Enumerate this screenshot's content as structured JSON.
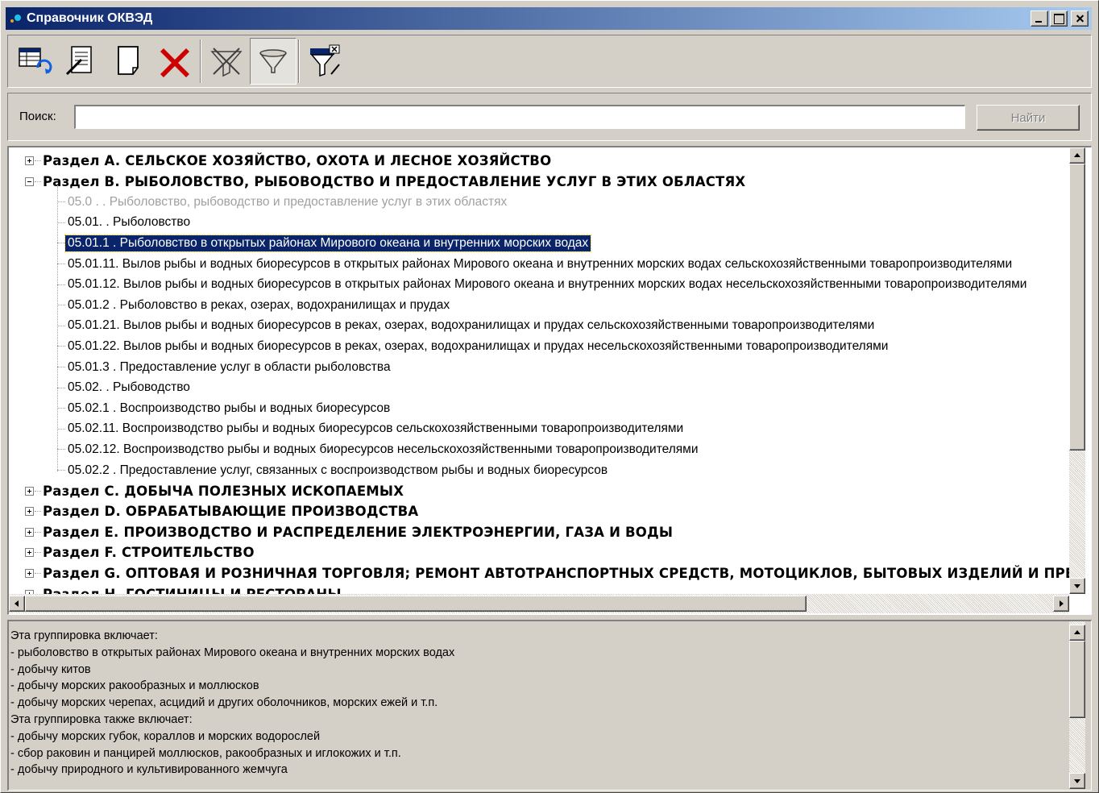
{
  "window": {
    "title": "Справочник ОКВЭД"
  },
  "toolbar": {
    "tools": [
      {
        "name": "refresh-table",
        "icon": "table-refresh-icon"
      },
      {
        "name": "edit-document",
        "icon": "document-edit-icon"
      },
      {
        "name": "new-document",
        "icon": "blank-page-icon"
      },
      {
        "name": "delete",
        "icon": "red-x-icon"
      },
      {
        "name": "clear-filter",
        "icon": "filter-clear-icon"
      },
      {
        "name": "filter",
        "icon": "funnel-icon",
        "pressed": true
      },
      {
        "name": "filter-settings",
        "icon": "filter-settings-icon"
      }
    ]
  },
  "search": {
    "label": "Поиск:",
    "value": "",
    "button_label": "Найти"
  },
  "tree": {
    "rows": [
      {
        "type": "section",
        "expanded": false,
        "text": "Раздел A. СЕЛЬСКОЕ ХОЗЯЙСТВО, ОХОТА И ЛЕСНОЕ ХОЗЯЙСТВО"
      },
      {
        "type": "section",
        "expanded": true,
        "text": "Раздел B. РЫБОЛОВСТВО, РЫБОВОДСТВО И ПРЕДОСТАВЛЕНИЕ УСЛУГ В ЭТИХ ОБЛАСТЯХ"
      },
      {
        "type": "leaf",
        "grey": true,
        "text": "05.0 . . Рыболовство, рыбоводство и предоставление услуг  в  этих областях"
      },
      {
        "type": "leaf",
        "text": "05.01.  . Рыболовство"
      },
      {
        "type": "leaf",
        "selected": true,
        "text": "05.01.1 . Рыболовство в открытых районах Мирового океана и внутренних морских водах"
      },
      {
        "type": "leaf",
        "text": "05.01.11. Вылов рыбы  и  водных  биоресурсов  в  открытых  районах Мирового   океана    и    внутренних    морских    водах сельскохозяйственными товаропроизводителями"
      },
      {
        "type": "leaf",
        "text": "05.01.12. Вылов рыбы  и  водных  биоресурсов  в  открытых  районах Мирового    океана    и    внутренних    морских   водах несельскохозяйственными товаропроизводителями"
      },
      {
        "type": "leaf",
        "text": "05.01.2 . Рыболовство в реках, озерах, водохранилищах и прудах"
      },
      {
        "type": "leaf",
        "text": "05.01.21. Вылов рыбы  и  водных  биоресурсов  в   реках,   озерах, водохранилищах    и    прудах   сельскохозяйственными товаропроизводителями"
      },
      {
        "type": "leaf",
        "text": "05.01.22. Вылов рыбы   и   водных  биоресурсов  в  реках,  озерах, водохранилищах    и    прудах    несельскохозяйственными товаропроизводителями"
      },
      {
        "type": "leaf",
        "text": "05.01.3 . Предоставление услуг в области рыболовства"
      },
      {
        "type": "leaf",
        "text": "05.02.  . Рыбоводство"
      },
      {
        "type": "leaf",
        "text": "05.02.1 . Воспроизводство рыбы и водных биоресурсов"
      },
      {
        "type": "leaf",
        "text": "05.02.11. Воспроизводство рыбы      и      водных      биоресурсов сельскохозяйственными товаропроизводителями"
      },
      {
        "type": "leaf",
        "text": "05.02.12. Воспроизводство рыбы      и      водных      биоресурсов несельскохозяйственными товаропроизводителями"
      },
      {
        "type": "leaf",
        "last": true,
        "text": "05.02.2 . Предоставление услуг,  связанных с воспроизводством рыбы и водных биоресурсов"
      },
      {
        "type": "section",
        "expanded": false,
        "text": "Раздел C. ДОБЫЧА ПОЛЕЗНЫХ ИСКОПАЕМЫХ"
      },
      {
        "type": "section",
        "expanded": false,
        "text": "Раздел D. ОБРАБАТЫВАЮЩИЕ ПРОИЗВОДСТВА"
      },
      {
        "type": "section",
        "expanded": false,
        "text": "Раздел E. ПРОИЗВОДСТВО И РАСПРЕДЕЛЕНИЕ ЭЛЕКТРОЭНЕРГИИ, ГАЗА И ВОДЫ"
      },
      {
        "type": "section",
        "expanded": false,
        "text": "Раздел F. СТРОИТЕЛЬСТВО"
      },
      {
        "type": "section",
        "expanded": false,
        "text": "Раздел G. ОПТОВАЯ И РОЗНИЧНАЯ ТОРГОВЛЯ; РЕМОНТ АВТОТРАНСПОРТНЫХ СРЕДСТВ, МОТОЦИКЛОВ, БЫТОВЫХ ИЗДЕЛИЙ И ПРЕДМЕТОВ ЛИЧНОГО ПОЛЬЗОВАНИЯ"
      },
      {
        "type": "section",
        "expanded": false,
        "text": "Раздел H. ГОСТИНИЦЫ И РЕСТОРАНЫ"
      }
    ]
  },
  "description": {
    "lines": [
      "Эта группировка включает:",
      "- рыболовство в открытых районах Мирового океана и внутренних морских водах",
      "- добычу китов",
      "- добычу морских ракообразных и моллюсков",
      "- добычу морских черепах, асцидий и других оболочников, морских ежей и т.п.",
      "Эта группировка также включает:",
      "- добычу морских губок, кораллов и морских водорослей",
      "- сбор раковин и панцирей моллюсков, ракообразных и иглокожих и т.п.",
      "- добычу природного и культивированного жемчуга"
    ]
  },
  "colors": {
    "title_bar": "#0a246a",
    "selection": "#0a246a",
    "delete_icon": "#cc0000",
    "face": "#d4d0c8"
  }
}
